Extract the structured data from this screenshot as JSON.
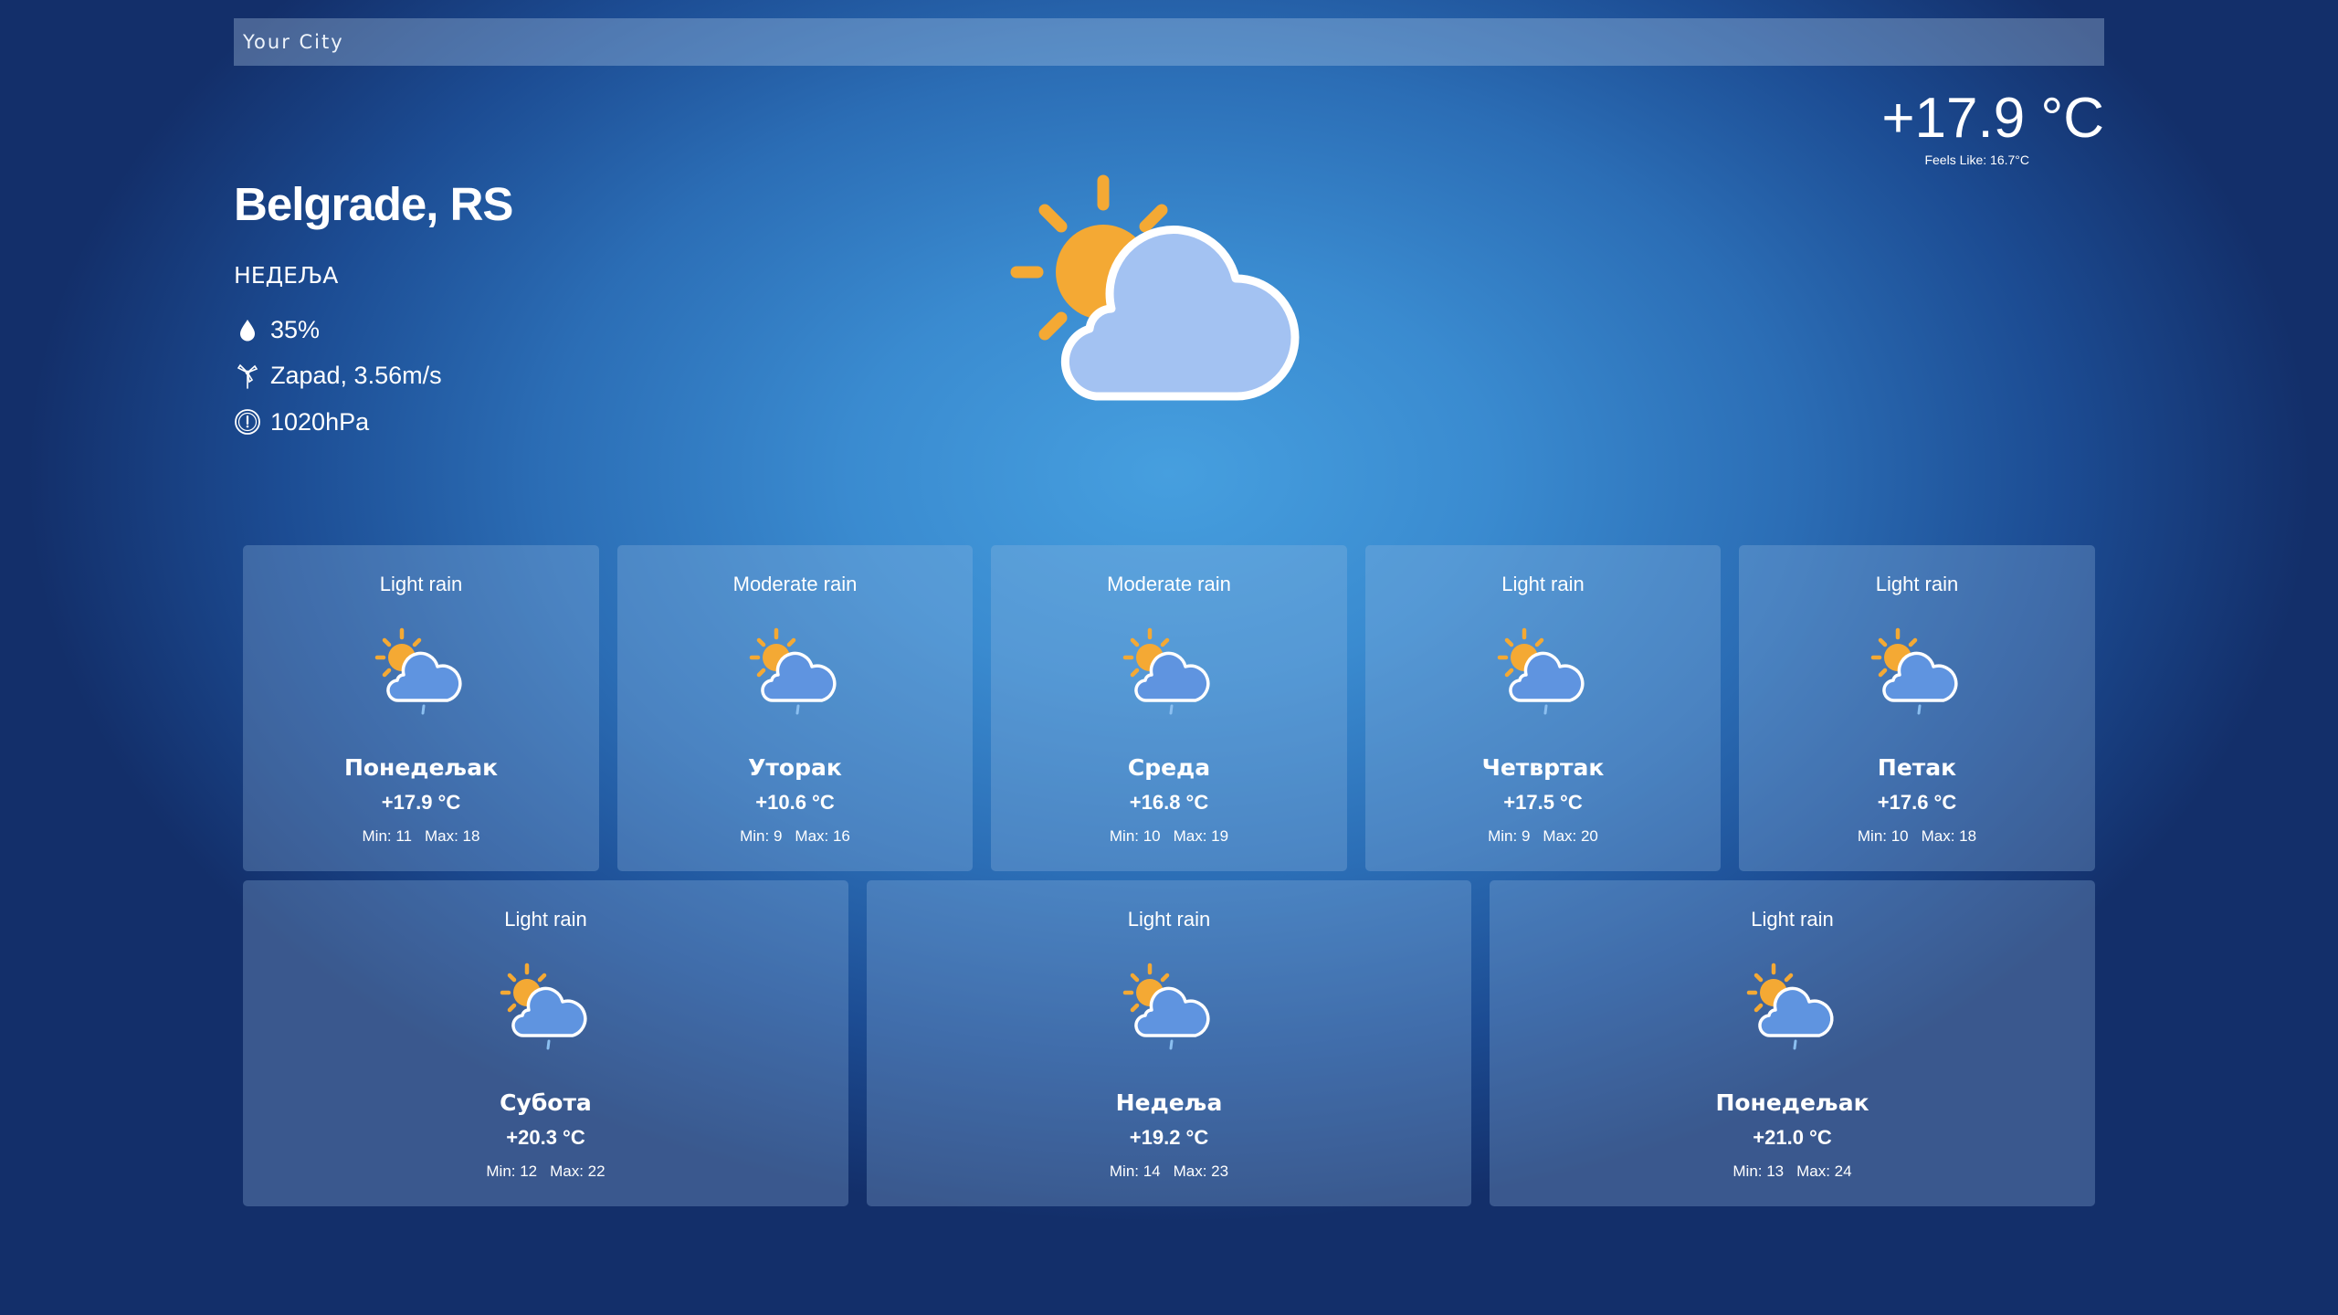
{
  "search": {
    "placeholder": "Your City"
  },
  "current": {
    "city": "Belgrade, RS",
    "day": "НЕДЕЉА",
    "humidity": "35%",
    "wind": "Zapad, 3.56m/s",
    "pressure": "1020hPa",
    "temperature": "+17.9 °C",
    "feels_like": "Feels Like: 16.7°C",
    "icon": "partly-cloudy-icon"
  },
  "icons": {
    "humidity": "water-drop-icon",
    "wind": "wind-icon",
    "pressure": "pressure-gauge-icon",
    "forecast": "sun-cloud-rain-icon"
  },
  "forecast": [
    {
      "desc": "Light rain",
      "day": "Понедељак",
      "temp": "+17.9 °C",
      "min": "Min: 11",
      "max": "Max: 18"
    },
    {
      "desc": "Moderate rain",
      "day": "Уторак",
      "temp": "+10.6 °C",
      "min": "Min: 9",
      "max": "Max: 16"
    },
    {
      "desc": "Moderate rain",
      "day": "Среда",
      "temp": "+16.8 °C",
      "min": "Min: 10",
      "max": "Max: 19"
    },
    {
      "desc": "Light rain",
      "day": "Четвртак",
      "temp": "+17.5 °C",
      "min": "Min: 9",
      "max": "Max: 20"
    },
    {
      "desc": "Light rain",
      "day": "Петак",
      "temp": "+17.6 °C",
      "min": "Min: 10",
      "max": "Max: 18"
    },
    {
      "desc": "Light rain",
      "day": "Субота",
      "temp": "+20.3 °C",
      "min": "Min: 12",
      "max": "Max: 22"
    },
    {
      "desc": "Light rain",
      "day": "Недеља",
      "temp": "+19.2 °C",
      "min": "Min: 14",
      "max": "Max: 23"
    },
    {
      "desc": "Light rain",
      "day": "Понедељак",
      "temp": "+21.0 °C",
      "min": "Min: 13",
      "max": "Max: 24"
    }
  ],
  "colors": {
    "sun": "#f4a934",
    "cloud_main": "#a3c2f2",
    "cloud_small": "#5f94e0",
    "rain": "#8bbff0"
  }
}
